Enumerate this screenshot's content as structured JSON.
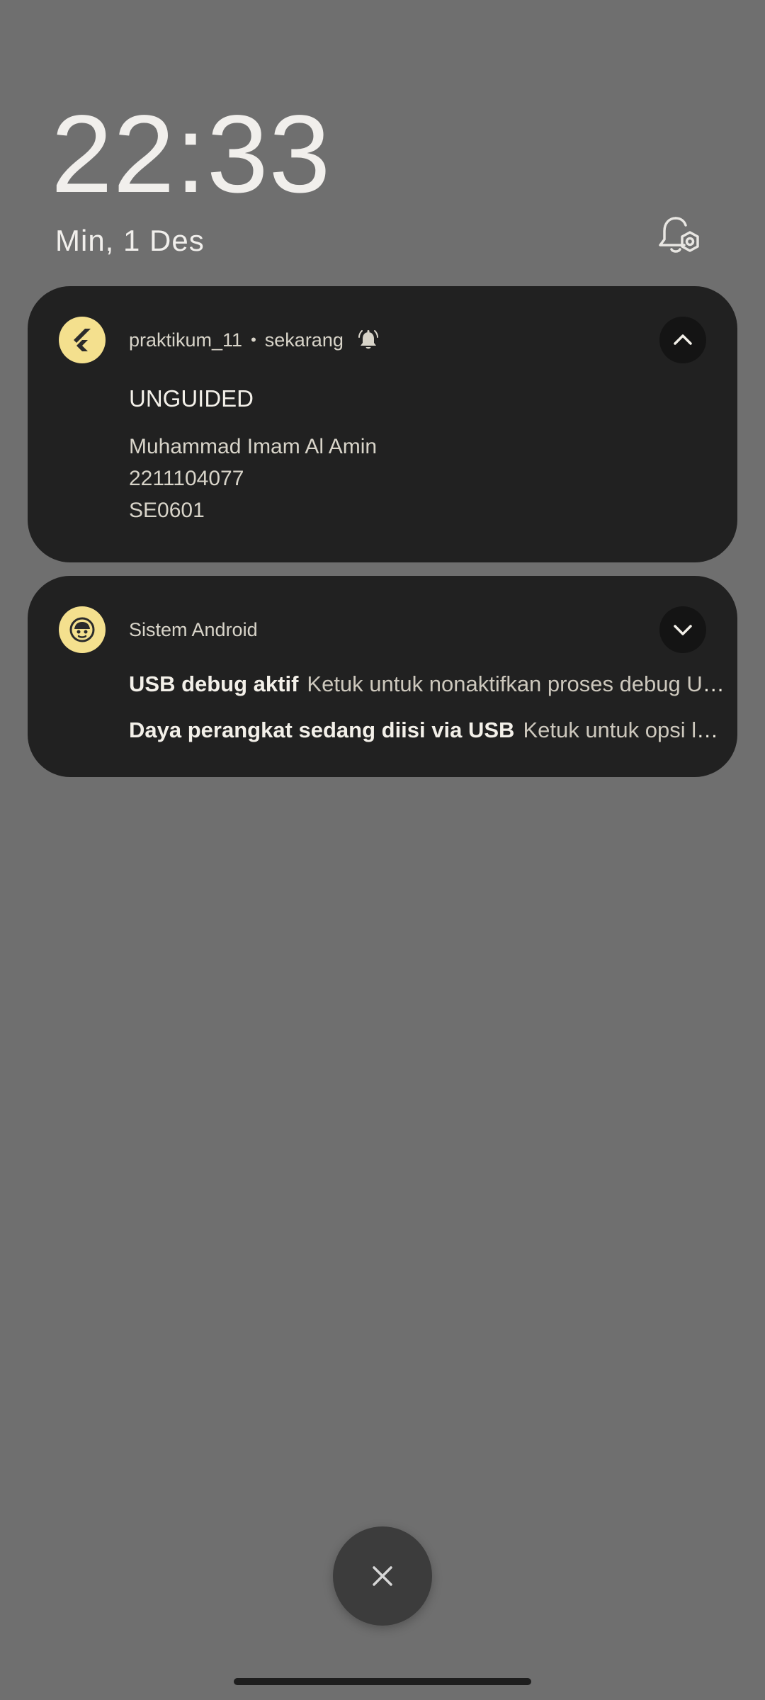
{
  "lockscreen": {
    "time": "22:33",
    "date": "Min, 1 Des"
  },
  "notifications": [
    {
      "app_name": "praktikum_11",
      "separator": "•",
      "time_label": "sekarang",
      "title": "UNGUIDED",
      "body_lines": [
        "Muhammad Imam Al Amin",
        "2211104077",
        "SE0601"
      ],
      "icon": "flutter-icon",
      "expanded": true
    },
    {
      "app_name": "Sistem Android",
      "icon": "android-system-icon",
      "expanded": false,
      "lines": [
        {
          "title": "USB debug aktif",
          "text": "Ketuk untuk nonaktifkan proses debug USB"
        },
        {
          "title": "Daya perangkat sedang diisi via USB",
          "text": "Ketuk untuk opsi lainnya"
        }
      ]
    }
  ],
  "dismiss_button": {
    "icon": "close-icon"
  },
  "colors": {
    "background": "#6f6f6f",
    "card": "#212121",
    "icon_accent": "#f4e08e"
  }
}
